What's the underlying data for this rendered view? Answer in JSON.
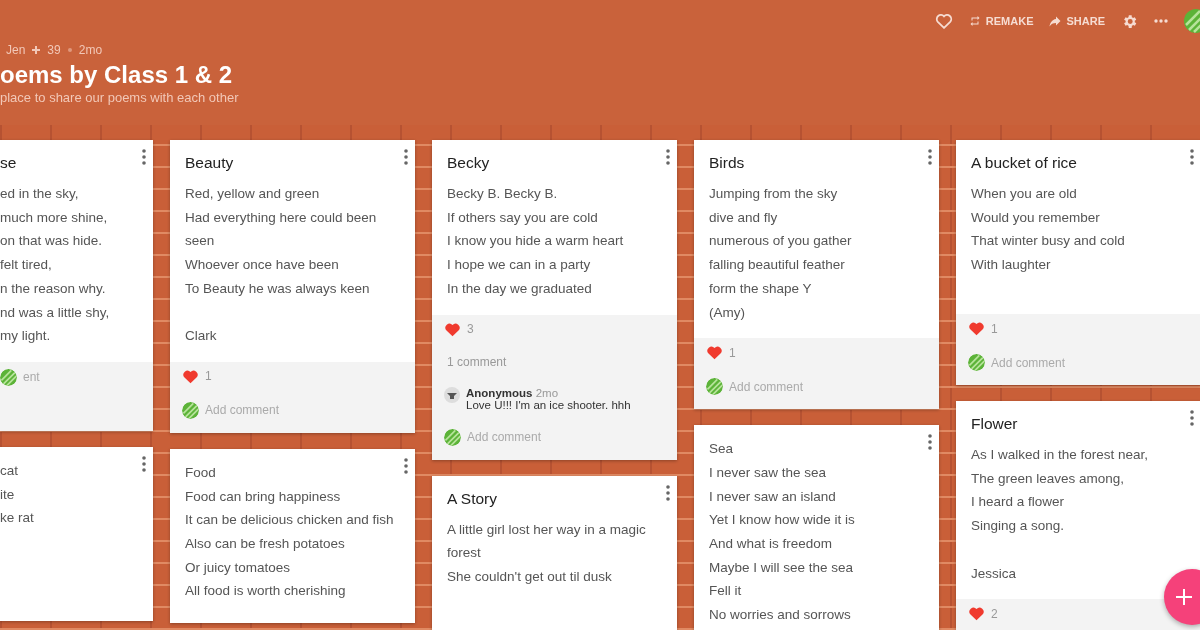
{
  "header": {
    "actions": [
      {
        "kind": "like"
      },
      {
        "kind": "remake",
        "label": "REMAKE"
      },
      {
        "kind": "share",
        "label": "SHARE"
      },
      {
        "kind": "settings"
      },
      {
        "kind": "more"
      },
      {
        "kind": "avatar"
      }
    ],
    "author": "Jen",
    "contributors": "39",
    "age": "2mo",
    "title": "oems by Class 1 & 2",
    "subtitle": "place to share our poems with each other"
  },
  "columns": [
    {
      "posts": [
        {
          "title": "se",
          "lines": [
            "ed in the sky,",
            "much more shine,",
            "on that was hide.",
            "felt tired,",
            "n the reason why.",
            "nd was a little shy,",
            "my light."
          ],
          "add_comment": "ent"
        },
        {
          "lines": [
            "cat",
            "ite",
            "ke rat"
          ]
        }
      ]
    },
    {
      "posts": [
        {
          "title": "Beauty",
          "lines": [
            "Red,  yellow and green",
            "Had everything here could been seen",
            "Whoever once have been",
            "To Beauty he was always keen"
          ],
          "signature": "Clark",
          "likes": "1",
          "add_comment": "Add comment"
        },
        {
          "lines": [
            "Food",
            "Food can bring happiness",
            "It can be delicious chicken and fish",
            "Also can be fresh potatoes",
            "Or juicy tomatoes",
            "All food is worth cherishing"
          ]
        }
      ]
    },
    {
      "posts": [
        {
          "title": "Becky",
          "lines": [
            "Becky B. Becky B.",
            "If others say you are cold",
            "I know you hide a warm heart",
            "I hope we can in a party",
            "In the day we graduated"
          ],
          "likes": "3",
          "comment_count": "1 comment",
          "comments": [
            {
              "author": "Anonymous",
              "age": "2mo",
              "text": "Love U!!! I'm an ice shooter. hhh"
            }
          ],
          "add_comment": "Add comment"
        },
        {
          "title": "A  Story",
          "lines": [
            "A little girl lost her way in a magic forest",
            "She couldn't get out til dusk"
          ]
        }
      ]
    },
    {
      "posts": [
        {
          "title": "Birds",
          "lines": [
            "Jumping from the sky",
            "dive and fly",
            "numerous of you gather",
            "falling beautiful feather",
            "form the shape Y",
            "(Amy)"
          ],
          "likes": "1",
          "add_comment": "Add comment"
        },
        {
          "lines": [
            "Sea",
            "I never saw the sea",
            "I never saw an island",
            "Yet I know  how wide it is",
            "And what is freedom",
            "Maybe I will see the sea",
            "Fell it",
            "No worries and sorrows"
          ]
        }
      ]
    },
    {
      "posts": [
        {
          "title": "A bucket of rice",
          "lines": [
            "When you are old",
            "Would you remember",
            "That winter busy and cold",
            "With laughter"
          ],
          "likes": "1",
          "add_comment": "Add comment"
        },
        {
          "title": "Flower",
          "lines": [
            "As I walked in the forest near,",
            "The green leaves among,",
            "I heard a flower",
            "Singing a song."
          ],
          "signature": "Jessica",
          "likes": "2"
        }
      ]
    }
  ]
}
